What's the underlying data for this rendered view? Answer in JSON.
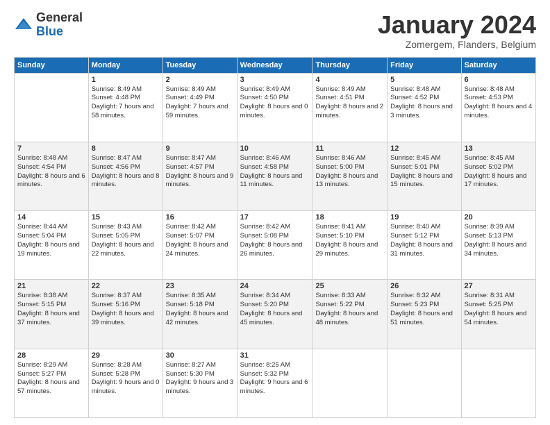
{
  "logo": {
    "general": "General",
    "blue": "Blue"
  },
  "header": {
    "month": "January 2024",
    "location": "Zomergem, Flanders, Belgium"
  },
  "days": [
    "Sunday",
    "Monday",
    "Tuesday",
    "Wednesday",
    "Thursday",
    "Friday",
    "Saturday"
  ],
  "weeks": [
    [
      {
        "day": "",
        "content": ""
      },
      {
        "day": "1",
        "content": "Sunrise: 8:49 AM\nSunset: 4:48 PM\nDaylight: 7 hours\nand 58 minutes."
      },
      {
        "day": "2",
        "content": "Sunrise: 8:49 AM\nSunset: 4:49 PM\nDaylight: 7 hours\nand 59 minutes."
      },
      {
        "day": "3",
        "content": "Sunrise: 8:49 AM\nSunset: 4:50 PM\nDaylight: 8 hours\nand 0 minutes."
      },
      {
        "day": "4",
        "content": "Sunrise: 8:49 AM\nSunset: 4:51 PM\nDaylight: 8 hours\nand 2 minutes."
      },
      {
        "day": "5",
        "content": "Sunrise: 8:48 AM\nSunset: 4:52 PM\nDaylight: 8 hours\nand 3 minutes."
      },
      {
        "day": "6",
        "content": "Sunrise: 8:48 AM\nSunset: 4:53 PM\nDaylight: 8 hours\nand 4 minutes."
      }
    ],
    [
      {
        "day": "7",
        "content": "Sunrise: 8:48 AM\nSunset: 4:54 PM\nDaylight: 8 hours\nand 6 minutes."
      },
      {
        "day": "8",
        "content": "Sunrise: 8:47 AM\nSunset: 4:56 PM\nDaylight: 8 hours\nand 8 minutes."
      },
      {
        "day": "9",
        "content": "Sunrise: 8:47 AM\nSunset: 4:57 PM\nDaylight: 8 hours\nand 9 minutes."
      },
      {
        "day": "10",
        "content": "Sunrise: 8:46 AM\nSunset: 4:58 PM\nDaylight: 8 hours\nand 11 minutes."
      },
      {
        "day": "11",
        "content": "Sunrise: 8:46 AM\nSunset: 5:00 PM\nDaylight: 8 hours\nand 13 minutes."
      },
      {
        "day": "12",
        "content": "Sunrise: 8:45 AM\nSunset: 5:01 PM\nDaylight: 8 hours\nand 15 minutes."
      },
      {
        "day": "13",
        "content": "Sunrise: 8:45 AM\nSunset: 5:02 PM\nDaylight: 8 hours\nand 17 minutes."
      }
    ],
    [
      {
        "day": "14",
        "content": "Sunrise: 8:44 AM\nSunset: 5:04 PM\nDaylight: 8 hours\nand 19 minutes."
      },
      {
        "day": "15",
        "content": "Sunrise: 8:43 AM\nSunset: 5:05 PM\nDaylight: 8 hours\nand 22 minutes."
      },
      {
        "day": "16",
        "content": "Sunrise: 8:42 AM\nSunset: 5:07 PM\nDaylight: 8 hours\nand 24 minutes."
      },
      {
        "day": "17",
        "content": "Sunrise: 8:42 AM\nSunset: 5:08 PM\nDaylight: 8 hours\nand 26 minutes."
      },
      {
        "day": "18",
        "content": "Sunrise: 8:41 AM\nSunset: 5:10 PM\nDaylight: 8 hours\nand 29 minutes."
      },
      {
        "day": "19",
        "content": "Sunrise: 8:40 AM\nSunset: 5:12 PM\nDaylight: 8 hours\nand 31 minutes."
      },
      {
        "day": "20",
        "content": "Sunrise: 8:39 AM\nSunset: 5:13 PM\nDaylight: 8 hours\nand 34 minutes."
      }
    ],
    [
      {
        "day": "21",
        "content": "Sunrise: 8:38 AM\nSunset: 5:15 PM\nDaylight: 8 hours\nand 37 minutes."
      },
      {
        "day": "22",
        "content": "Sunrise: 8:37 AM\nSunset: 5:16 PM\nDaylight: 8 hours\nand 39 minutes."
      },
      {
        "day": "23",
        "content": "Sunrise: 8:35 AM\nSunset: 5:18 PM\nDaylight: 8 hours\nand 42 minutes."
      },
      {
        "day": "24",
        "content": "Sunrise: 8:34 AM\nSunset: 5:20 PM\nDaylight: 8 hours\nand 45 minutes."
      },
      {
        "day": "25",
        "content": "Sunrise: 8:33 AM\nSunset: 5:22 PM\nDaylight: 8 hours\nand 48 minutes."
      },
      {
        "day": "26",
        "content": "Sunrise: 8:32 AM\nSunset: 5:23 PM\nDaylight: 8 hours\nand 51 minutes."
      },
      {
        "day": "27",
        "content": "Sunrise: 8:31 AM\nSunset: 5:25 PM\nDaylight: 8 hours\nand 54 minutes."
      }
    ],
    [
      {
        "day": "28",
        "content": "Sunrise: 8:29 AM\nSunset: 5:27 PM\nDaylight: 8 hours\nand 57 minutes."
      },
      {
        "day": "29",
        "content": "Sunrise: 8:28 AM\nSunset: 5:28 PM\nDaylight: 9 hours\nand 0 minutes."
      },
      {
        "day": "30",
        "content": "Sunrise: 8:27 AM\nSunset: 5:30 PM\nDaylight: 9 hours\nand 3 minutes."
      },
      {
        "day": "31",
        "content": "Sunrise: 8:25 AM\nSunset: 5:32 PM\nDaylight: 9 hours\nand 6 minutes."
      },
      {
        "day": "",
        "content": ""
      },
      {
        "day": "",
        "content": ""
      },
      {
        "day": "",
        "content": ""
      }
    ]
  ]
}
